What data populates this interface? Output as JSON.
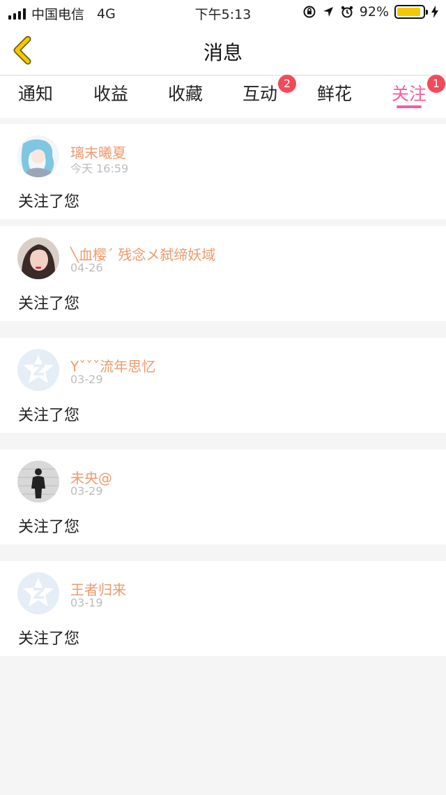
{
  "status_bar": {
    "carrier": "中国电信",
    "network": "4G",
    "time": "下午5:13",
    "battery": "92%",
    "battery_level": 0.92,
    "battery_color": "#f4c800"
  },
  "nav": {
    "title": "消息",
    "back_icon": "chevron-left-icon",
    "back_color": "#e6b800"
  },
  "tabs": [
    {
      "label": "通知",
      "badge": ""
    },
    {
      "label": "收益",
      "badge": ""
    },
    {
      "label": "收藏",
      "badge": ""
    },
    {
      "label": "互动",
      "badge": "2"
    },
    {
      "label": "鲜花",
      "badge": ""
    },
    {
      "label": "关注",
      "badge": "1",
      "active": true
    }
  ],
  "accent_color": "#f060a0",
  "name_color": "#ee9a6c",
  "items": [
    {
      "name": "璃末曦夏",
      "time": "今天 16:59",
      "text": "关注了您",
      "avatar": "anime-girl-avatar"
    },
    {
      "name": "╲血樱ˊ 残念メ弑缔妖域",
      "time": "04-26",
      "text": "关注了您",
      "avatar": "photo-avatar"
    },
    {
      "name": "Yˇˇˇ流年思忆",
      "time": "03-29",
      "text": "关注了您",
      "avatar": "default-qzone-avatar"
    },
    {
      "name": "未央@",
      "time": "03-29",
      "text": "关注了您",
      "avatar": "photo-avatar"
    },
    {
      "name": "王者归来",
      "time": "03-19",
      "text": "关注了您",
      "avatar": "default-qzone-avatar"
    }
  ]
}
